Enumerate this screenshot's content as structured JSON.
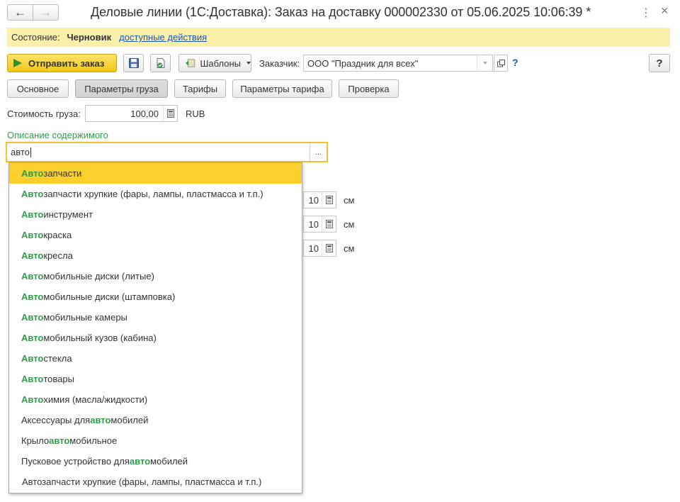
{
  "window": {
    "title": "Деловые линии (1С:Доставка): Заказ на доставку 000002330 от 05.06.2025 10:06:39 *",
    "back_icon": "←",
    "forward_icon": "→",
    "menu_icon": "⋮",
    "close_icon": "×"
  },
  "status": {
    "label": "Состояние:",
    "value": "Черновик",
    "actions_link": "доступные действия"
  },
  "toolbar": {
    "send_label": "Отправить заказ",
    "templates_label": "Шаблоны",
    "customer_label": "Заказчик:",
    "customer_value": "ООО \"Праздник для всех\"",
    "customer_help": "?",
    "help_label": "?"
  },
  "tabs": [
    {
      "label": "Основное"
    },
    {
      "label": "Параметры груза"
    },
    {
      "label": "Тарифы"
    },
    {
      "label": "Параметры тарифа"
    },
    {
      "label": "Проверка"
    }
  ],
  "cargo": {
    "cost_label": "Стоимость груза:",
    "cost_value": "100,00",
    "currency": "RUB",
    "description_label": "Описание содержимого",
    "description_value": "авто",
    "more_label": "...",
    "dimensions": [
      {
        "value": "10",
        "unit": "см"
      },
      {
        "value": "10",
        "unit": "см"
      },
      {
        "value": "10",
        "unit": "см"
      }
    ]
  },
  "suggestions": [
    {
      "pre": "",
      "match": "Авто",
      "post": "запчасти",
      "selected": true
    },
    {
      "pre": "",
      "match": "Авто",
      "post": "запчасти хрупкие (фары, лампы, пластмасса и т.п.)"
    },
    {
      "pre": "",
      "match": "Авто",
      "post": "инструмент"
    },
    {
      "pre": "",
      "match": "Авто",
      "post": "краска"
    },
    {
      "pre": "",
      "match": "Авто",
      "post": "кресла"
    },
    {
      "pre": "",
      "match": "Авто",
      "post": "мобильные диски (литые)"
    },
    {
      "pre": "",
      "match": "Авто",
      "post": "мобильные диски (штамповка)"
    },
    {
      "pre": "",
      "match": "Авто",
      "post": "мобильные камеры"
    },
    {
      "pre": "",
      "match": "Авто",
      "post": "мобильный кузов (кабина)"
    },
    {
      "pre": "",
      "match": "Авто",
      "post": "стекла"
    },
    {
      "pre": "",
      "match": "Авто",
      "post": "товары"
    },
    {
      "pre": "",
      "match": "Авто",
      "post": "химия (масла/жидкости)"
    },
    {
      "pre": "Аксессуары для ",
      "match": "авто",
      "post": "мобилей"
    },
    {
      "pre": "Крыло ",
      "match": "авто",
      "post": "мобильное"
    },
    {
      "pre": "Пусковое устройство для ",
      "match": "авто",
      "post": "мобилей"
    },
    {
      "pre": "Автозапчасти хрупкие (фары, лампы, пластмасса и т.п.)",
      "match": "",
      "post": "",
      "plain": true
    }
  ]
}
